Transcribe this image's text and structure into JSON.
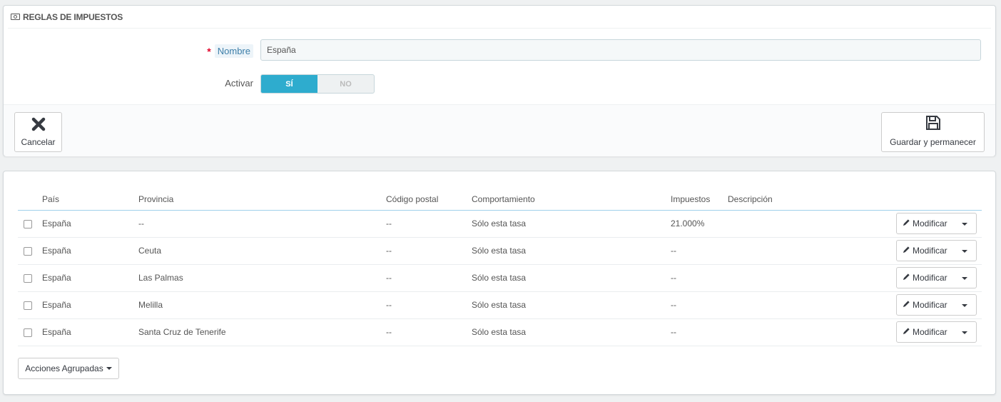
{
  "form": {
    "heading": "REGLAS DE IMPUESTOS",
    "name_label": "Nombre",
    "required_mark": "*",
    "name_value": "España",
    "active_label": "Activar",
    "switch_on": "SÍ",
    "switch_off": "NO",
    "cancel_label": "Cancelar",
    "save_label": "Guardar y permanecer"
  },
  "table": {
    "headers": {
      "country": "País",
      "province": "Provincia",
      "postal": "Código postal",
      "behavior": "Comportamiento",
      "tax": "Impuestos",
      "description": "Descripción"
    },
    "rows": [
      {
        "country": "España",
        "province": "--",
        "postal": "--",
        "behavior": "Sólo esta tasa",
        "tax": "21.000%",
        "description": ""
      },
      {
        "country": "España",
        "province": "Ceuta",
        "postal": "--",
        "behavior": "Sólo esta tasa",
        "tax": "--",
        "description": ""
      },
      {
        "country": "España",
        "province": "Las Palmas",
        "postal": "--",
        "behavior": "Sólo esta tasa",
        "tax": "--",
        "description": ""
      },
      {
        "country": "España",
        "province": "Melilla",
        "postal": "--",
        "behavior": "Sólo esta tasa",
        "tax": "--",
        "description": ""
      },
      {
        "country": "España",
        "province": "Santa Cruz de Tenerife",
        "postal": "--",
        "behavior": "Sólo esta tasa",
        "tax": "--",
        "description": ""
      }
    ],
    "edit_label": "Modificar",
    "bulk_label": "Acciones Agrupadas"
  },
  "colors": {
    "accent": "#2eacce",
    "required": "#e2062c",
    "label_link": "#3c7ea8"
  },
  "icons": {
    "heading": "money-icon",
    "cancel": "close-icon",
    "save": "floppy-disk-icon",
    "edit": "pencil-icon"
  }
}
